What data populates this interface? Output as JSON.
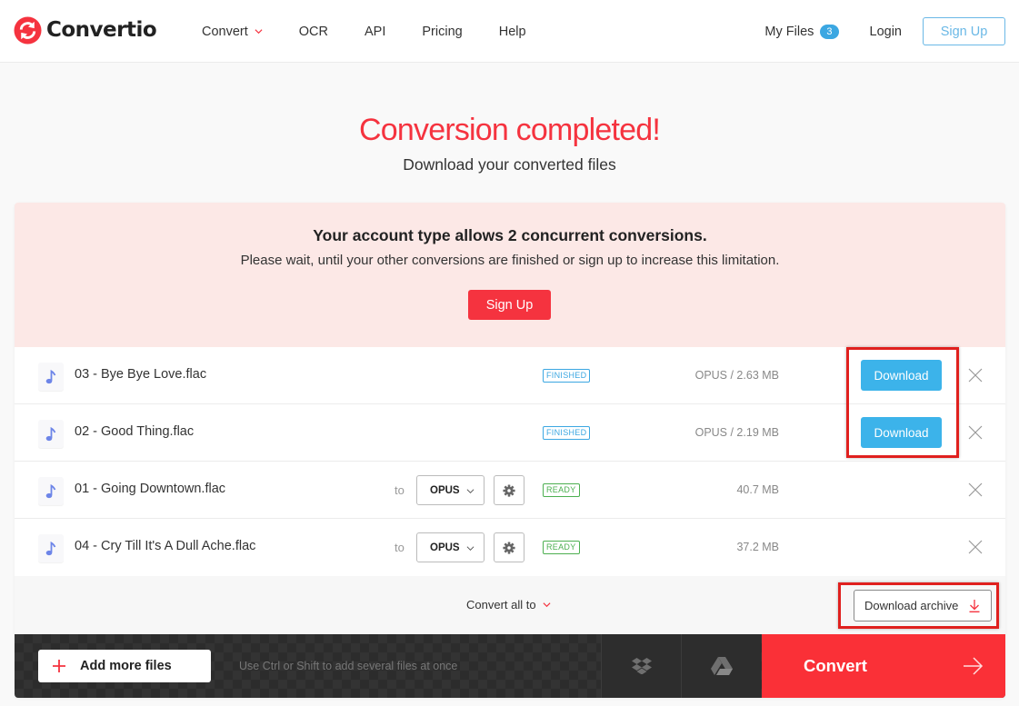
{
  "header": {
    "logo_text": "Convertio",
    "nav": [
      {
        "label": "Convert",
        "has_dropdown": true
      },
      {
        "label": "OCR"
      },
      {
        "label": "API"
      },
      {
        "label": "Pricing"
      },
      {
        "label": "Help"
      }
    ],
    "my_files_label": "My Files",
    "my_files_count": "3",
    "login_label": "Login",
    "signup_label": "Sign Up"
  },
  "hero": {
    "title": "Conversion completed!",
    "subtitle": "Download your converted files"
  },
  "notice": {
    "title": "Your account type allows 2 concurrent conversions.",
    "text": "Please wait, until your other conversions are finished or sign up to increase this limitation.",
    "button_label": "Sign Up"
  },
  "files": [
    {
      "name": "03 - Bye Bye Love.flac",
      "status": "FINISHED",
      "size": "OPUS / 2.63 MB",
      "action_label": "Download"
    },
    {
      "name": "02 - Good Thing.flac",
      "status": "FINISHED",
      "size": "OPUS / 2.19 MB",
      "action_label": "Download"
    },
    {
      "name": "01 - Going Downtown.flac",
      "to_label": "to",
      "format": "OPUS",
      "status": "READY",
      "size": "40.7 MB"
    },
    {
      "name": "04 - Cry Till It's A Dull Ache.flac",
      "to_label": "to",
      "format": "OPUS",
      "status": "READY",
      "size": "37.2 MB"
    }
  ],
  "bottom": {
    "convert_all_label": "Convert all to",
    "archive_label": "Download archive"
  },
  "actions": {
    "add_files_label": "Add more files",
    "hint": "Use Ctrl or Shift to add several files at once",
    "convert_label": "Convert"
  },
  "colors": {
    "brand_red": "#f5333f",
    "accent_blue": "#3cb3ea",
    "ready_green": "#4caf50",
    "notice_bg": "#fce8e6"
  }
}
